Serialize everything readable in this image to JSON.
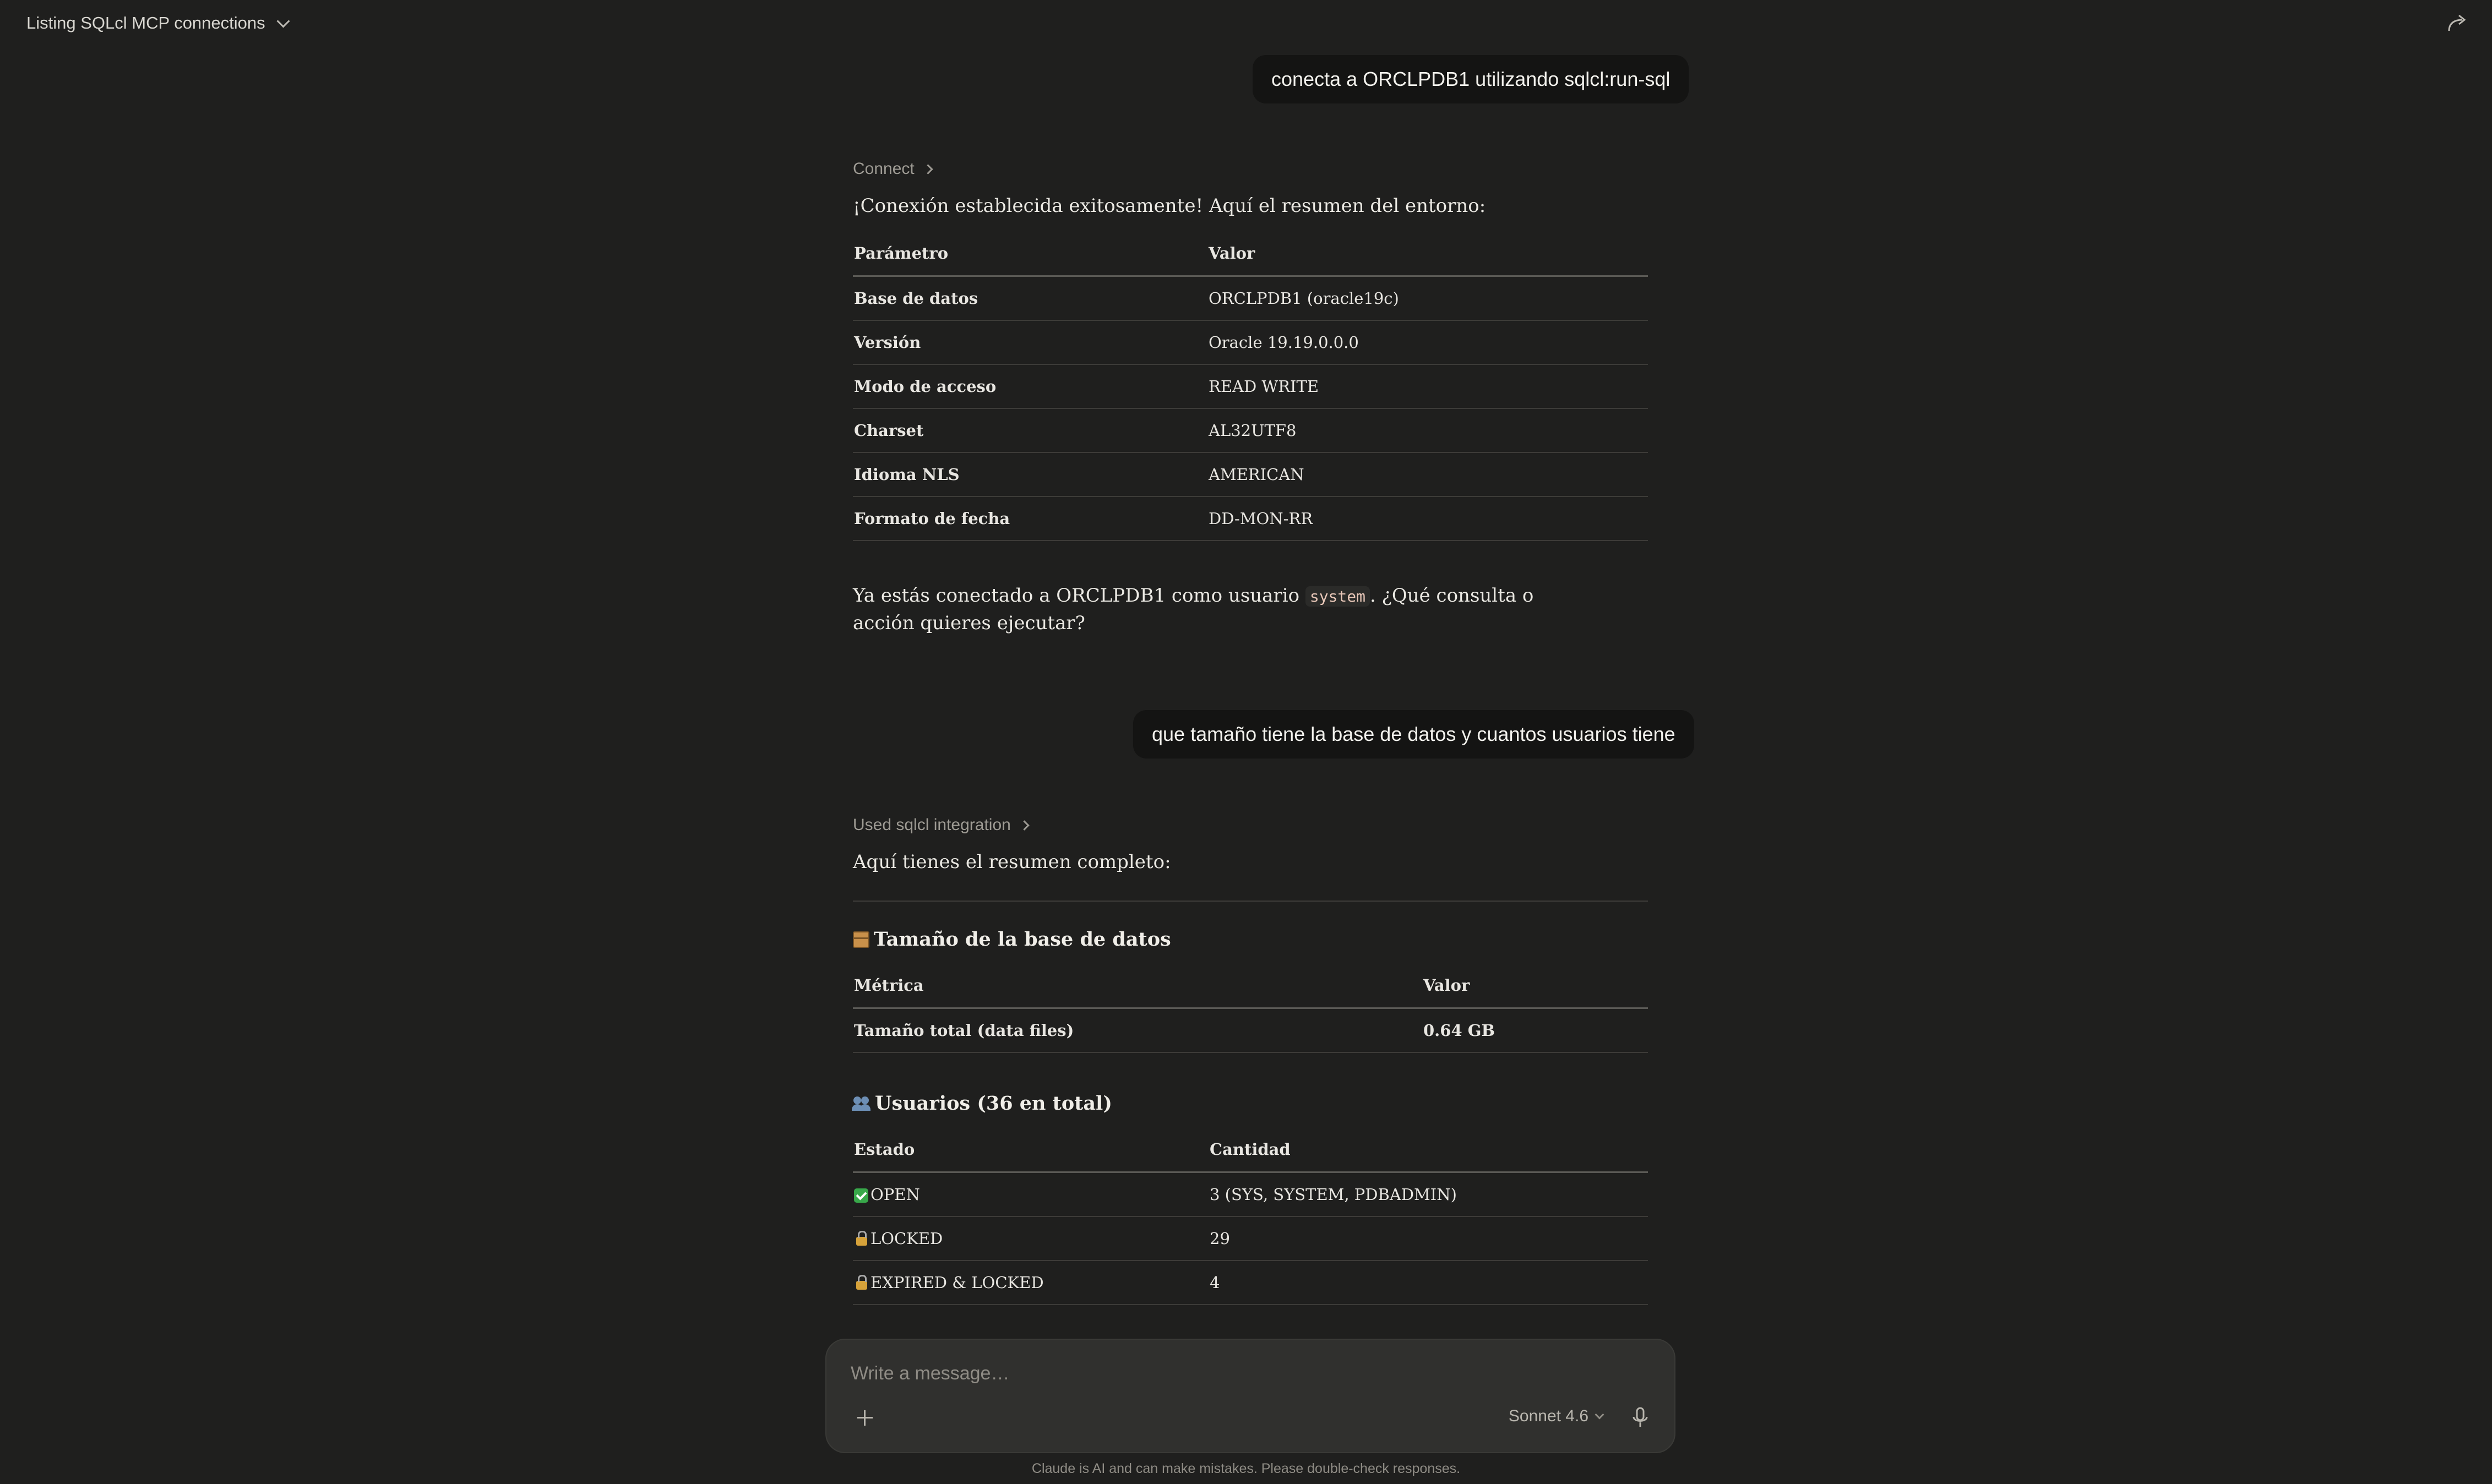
{
  "header": {
    "title": "Listing SQLcl MCP connections"
  },
  "messages": {
    "user1": "conecta a ORCLPDB1 utilizando sqlcl:run-sql",
    "tool1": "Connect",
    "intro1": "¡Conexión establecida exitosamente! Aquí el resumen del entorno:",
    "table1": {
      "headers": [
        "Parámetro",
        "Valor"
      ],
      "rows": [
        [
          "Base de datos",
          "ORCLPDB1 (oracle19c)"
        ],
        [
          "Versión",
          "Oracle 19.19.0.0.0"
        ],
        [
          "Modo de acceso",
          "READ WRITE"
        ],
        [
          "Charset",
          "AL32UTF8"
        ],
        [
          "Idioma NLS",
          "AMERICAN"
        ],
        [
          "Formato de fecha",
          "DD-MON-RR"
        ]
      ]
    },
    "outro1": {
      "before": "Ya estás conectado a ORCLPDB1 como usuario ",
      "code": "system",
      "after": ". ¿Qué consulta o acción quieres ejecutar?"
    },
    "user2": "que tamaño tiene la base de datos y cuantos usuarios tiene",
    "tool2": "Used sqlcl integration",
    "intro2": "Aquí tienes el resumen completo:",
    "section1": {
      "title": "Tamaño de la base de datos",
      "icon": "package-icon",
      "headers": [
        "Métrica",
        "Valor"
      ],
      "rows": [
        [
          "Tamaño total (data files)",
          "0.64 GB"
        ]
      ]
    },
    "section2": {
      "title": "Usuarios (36 en total)",
      "icon": "people-icon",
      "headers": [
        "Estado",
        "Cantidad"
      ],
      "rows": [
        [
          "OPEN",
          "3 (SYS, SYSTEM, PDBADMIN)"
        ],
        [
          "LOCKED",
          "29"
        ],
        [
          "EXPIRED & LOCKED",
          "4"
        ]
      ]
    }
  },
  "composer": {
    "placeholder": "Write a message…",
    "model": "Sonnet 4.6"
  },
  "footer": {
    "disclaimer": "Claude is AI and can make mistakes. Please double-check responses."
  }
}
